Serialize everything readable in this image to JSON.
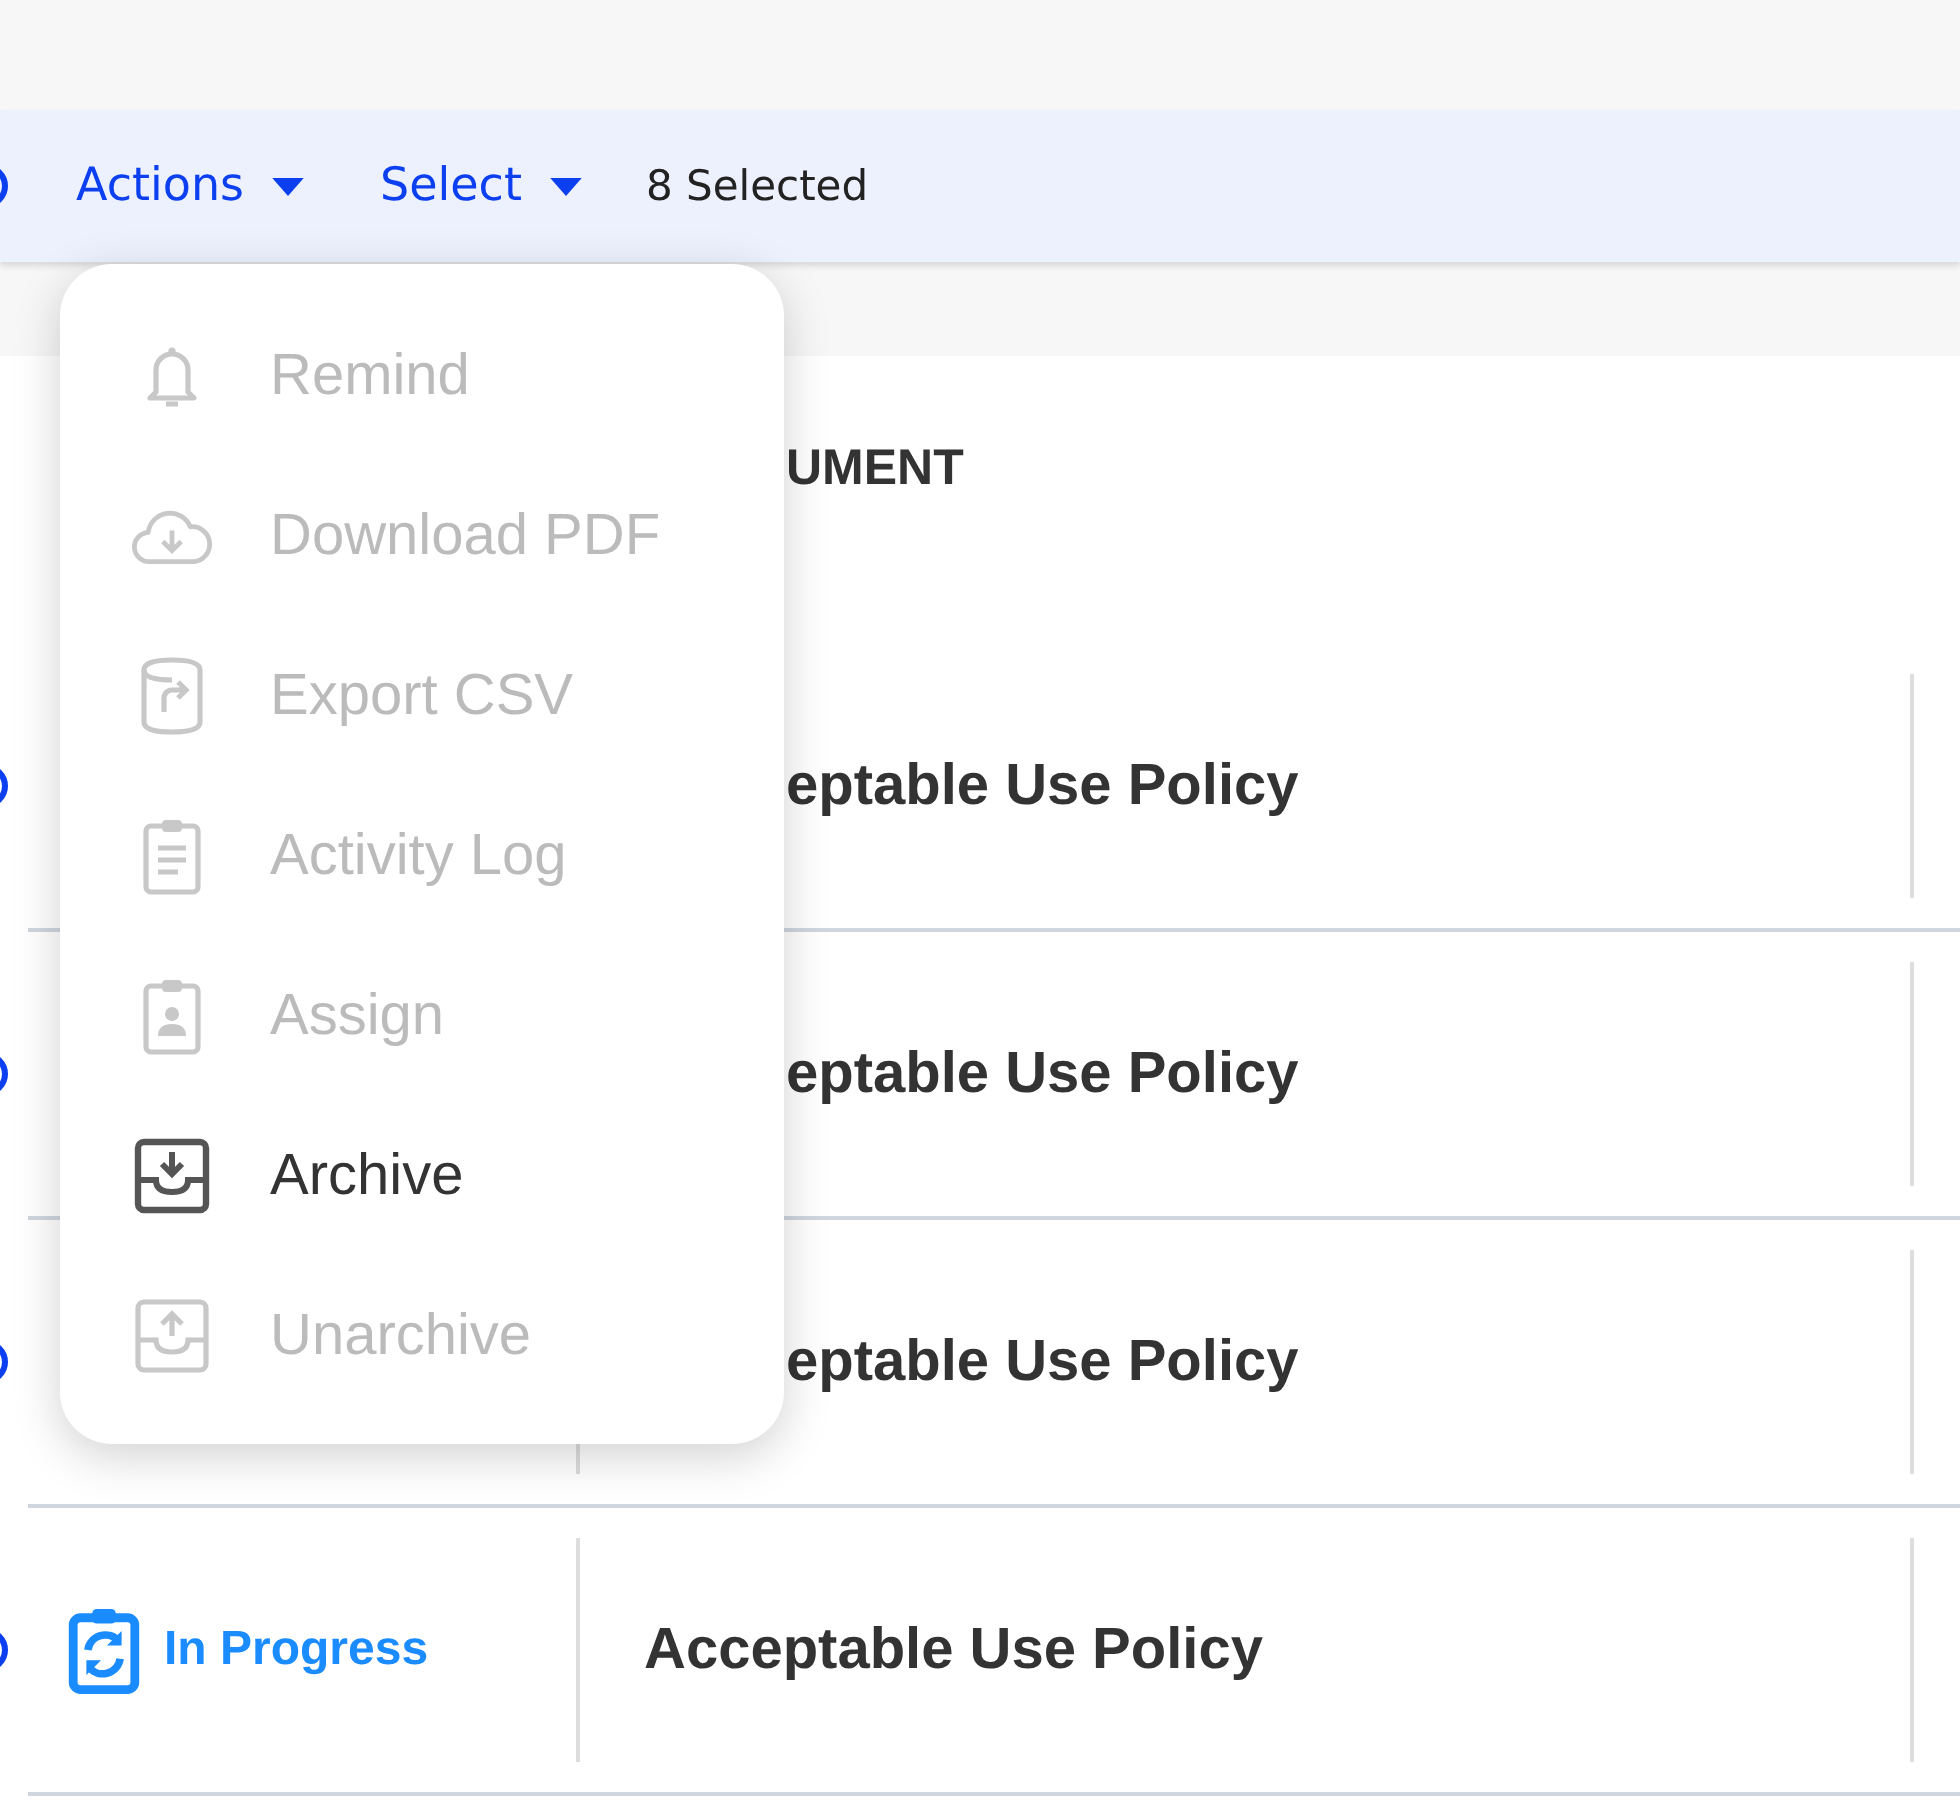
{
  "toolbar": {
    "select_all": {
      "checked": true
    },
    "actions_label": "Actions",
    "select_label": "Select",
    "selected_count": "8 Selected"
  },
  "menu": {
    "items": [
      {
        "kind": "bell",
        "label": "Remind",
        "disabled": true
      },
      {
        "kind": "cloud-download",
        "label": "Download PDF",
        "disabled": true
      },
      {
        "kind": "export",
        "label": "Export CSV",
        "disabled": true
      },
      {
        "kind": "clipboard-list",
        "label": "Activity Log",
        "disabled": true
      },
      {
        "kind": "clipboard-person",
        "label": "Assign",
        "disabled": true
      },
      {
        "kind": "archive",
        "label": "Archive",
        "disabled": false
      },
      {
        "kind": "unarchive",
        "label": "Unarchive",
        "disabled": true
      }
    ]
  },
  "table": {
    "column_header": "UMENT",
    "rows": [
      {
        "selected": true,
        "under_menu": true,
        "document": "eptable Use Policy"
      },
      {
        "selected": true,
        "under_menu": true,
        "document": "eptable Use Policy"
      },
      {
        "selected": true,
        "under_menu": true,
        "document": "eptable Use Policy"
      },
      {
        "selected": true,
        "under_menu": false,
        "status": "In Progress",
        "document": "Acceptable Use Policy"
      }
    ]
  }
}
